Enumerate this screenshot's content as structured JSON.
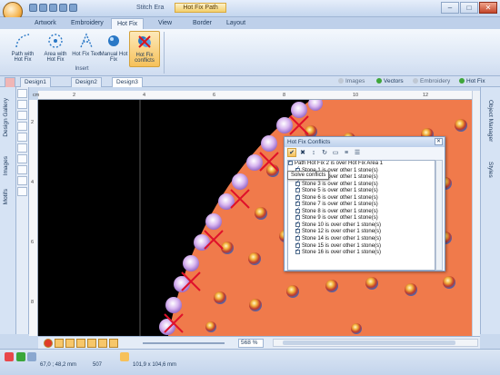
{
  "window": {
    "title": "Stitch Era",
    "context_tab": "Hot Fix Path",
    "controls": [
      "–",
      "□",
      "✕"
    ]
  },
  "ribbon_tabs": [
    "Artwork",
    "Embroidery",
    "Hot Fix",
    "View",
    "Border",
    "Layout"
  ],
  "active_ribbon_tab": "Hot Fix",
  "ribbon": {
    "group_label": "Insert",
    "buttons": [
      {
        "label": "Path with Hot Fix",
        "icon": "path-icon"
      },
      {
        "label": "Area with Hot Fix",
        "icon": "area-icon"
      },
      {
        "label": "Hot Fix Text",
        "icon": "text-icon"
      },
      {
        "label": "Manual Hot Fix",
        "icon": "manual-icon"
      },
      {
        "label": "Hot Fix conflicts",
        "icon": "conflicts-icon"
      }
    ]
  },
  "doc_tabs": [
    "Design1",
    "Design2",
    "Design3"
  ],
  "active_doc_tab": "Design3",
  "view_switch": [
    {
      "label": "Images",
      "on": false
    },
    {
      "label": "Vectors",
      "on": true
    },
    {
      "label": "Embroidery",
      "on": false
    },
    {
      "label": "Hot Fix",
      "on": true
    }
  ],
  "left_panels": [
    "Design Gallery",
    "Images",
    "Motifs"
  ],
  "right_panels": [
    "Object Manager",
    "Styles"
  ],
  "ruler": {
    "unit": "cm",
    "h_ticks": [
      "2",
      "4",
      "6",
      "8",
      "10",
      "12"
    ],
    "v_ticks": [
      "2",
      "4",
      "6",
      "8"
    ]
  },
  "hot_fix_conflicts": {
    "title": "Hot Fix Conflicts",
    "close": "✕",
    "tooltip": "Solve conflicts",
    "rows": [
      "Path Hot Fix 2 is over Hot Fix Area 1",
      "Stone 1 is over other 1 stone(s)",
      "Stone 2 is over other 1 stone(s)",
      "Stone 3 is over other 1 stone(s)",
      "Stone 5 is over other 1 stone(s)",
      "Stone 6 is over other 1 stone(s)",
      "Stone 7 is over other 1 stone(s)",
      "Stone 8 is over other 1 stone(s)",
      "Stone 9 is over other 1 stone(s)",
      "Stone 10 is over other 1 stone(s)",
      "Stone 12 is over other 1 stone(s)",
      "Stone 14 is over other 1 stone(s)",
      "Stone 15 is over other 1 stone(s)",
      "Stone 16 is over other 1 stone(s)"
    ]
  },
  "zoom": "568 %",
  "status": {
    "position": "67,0 ; 48,2 mm",
    "stitches": "507",
    "size": "101,9 x 104,6 mm"
  },
  "colors": {
    "canvas_bg": "#000000",
    "fabric": "#f07a4b",
    "stone_path": "#c9a6e6",
    "conflict_mark": "#e0102a"
  }
}
